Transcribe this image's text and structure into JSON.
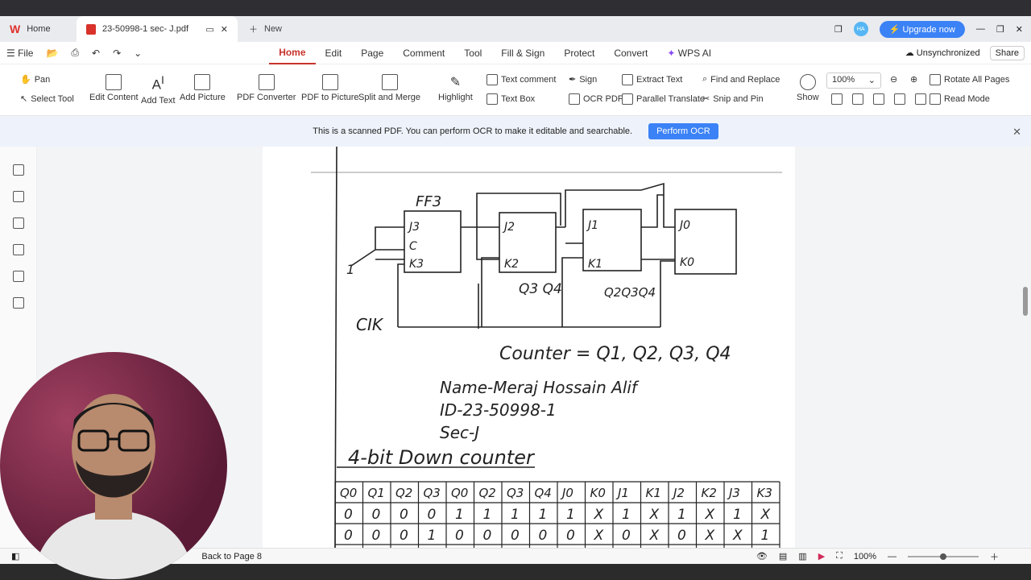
{
  "titlebar": {
    "home_tab": "Home",
    "doc_tab": "23-50998-1 sec- J.pdf",
    "new_tab": "New",
    "upgrade": "Upgrade now",
    "avatar_initials": "HA"
  },
  "menubar": {
    "file": "File",
    "tabs": [
      "Home",
      "Edit",
      "Page",
      "Comment",
      "Tool",
      "Fill & Sign",
      "Protect",
      "Convert",
      "WPS AI"
    ],
    "sync": "Unsynchronized",
    "share": "Share"
  },
  "ribbon": {
    "pan": "Pan",
    "select": "Select Tool",
    "edit_content": "Edit Content",
    "add_text": "Add Text",
    "add_picture": "Add Picture",
    "pdf_converter": "PDF Converter",
    "pdf_to_picture": "PDF to Picture",
    "split_merge": "Split and Merge",
    "highlight": "Highlight",
    "text_comment": "Text comment",
    "text_box": "Text Box",
    "sign": "Sign",
    "ocr_pdf": "OCR PDF",
    "extract_text": "Extract Text",
    "parallel_translate": "Parallel Translate",
    "find_replace": "Find and Replace",
    "snip_pin": "Snip and Pin",
    "show": "Show",
    "zoom": "100%",
    "rotate_all": "Rotate All Pages",
    "read_mode": "Read Mode"
  },
  "ocr": {
    "message": "This is a scanned PDF. You can perform OCR to make it editable and searchable.",
    "button": "Perform OCR"
  },
  "status": {
    "back": "Back to Page 8",
    "zoom": "100%"
  },
  "doc": {
    "ff_label": "FF3",
    "clk": "CIK",
    "q3q4": "Q3 Q4",
    "q2q3q4": "Q2Q3Q4",
    "counter": "Counter = Q1, Q2, Q3, Q4",
    "name": "Name-Meraj Hossain Alif",
    "id": "ID-23-50998-1",
    "sec": "Sec-J",
    "heading": "4-bit Down counter",
    "table_headers": [
      "Q0",
      "Q1",
      "Q2",
      "Q3",
      "Q0",
      "Q2",
      "Q3",
      "Q4",
      "J0",
      "K0",
      "J1",
      "K1",
      "J2",
      "K2",
      "J3",
      "K3"
    ],
    "table_rows": [
      [
        "0",
        "0",
        "0",
        "0",
        "1",
        "1",
        "1",
        "1",
        "1",
        "X",
        "1",
        "X",
        "1",
        "X",
        "1",
        "X"
      ],
      [
        "0",
        "0",
        "0",
        "1",
        "0",
        "0",
        "0",
        "0",
        "0",
        "X",
        "0",
        "X",
        "0",
        "X",
        "X",
        "1"
      ]
    ]
  }
}
